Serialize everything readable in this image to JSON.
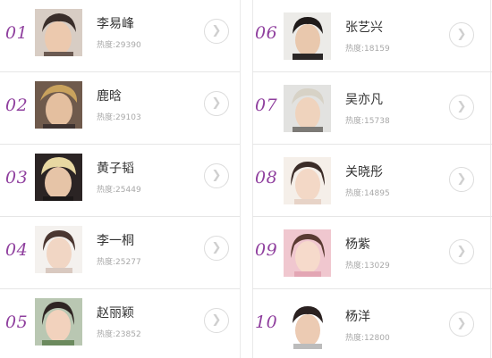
{
  "heat_prefix": "热度:",
  "arrow_icon": "chevron-right-icon",
  "accent_color": "#8f3f9e",
  "left": [
    {
      "rank": "01",
      "name": "李易峰",
      "heat": "29390"
    },
    {
      "rank": "02",
      "name": "鹿晗",
      "heat": "29103"
    },
    {
      "rank": "03",
      "name": "黄子韬",
      "heat": "25449"
    },
    {
      "rank": "04",
      "name": "李一桐",
      "heat": "25277"
    },
    {
      "rank": "05",
      "name": "赵丽颖",
      "heat": "23852"
    }
  ],
  "right": [
    {
      "rank": "06",
      "name": "张艺兴",
      "heat": "18159"
    },
    {
      "rank": "07",
      "name": "吴亦凡",
      "heat": "15738"
    },
    {
      "rank": "08",
      "name": "关晓彤",
      "heat": "14895"
    },
    {
      "rank": "09",
      "name": "杨紫",
      "heat": "13029"
    },
    {
      "rank": "10",
      "name": "杨洋",
      "heat": "12800"
    }
  ]
}
